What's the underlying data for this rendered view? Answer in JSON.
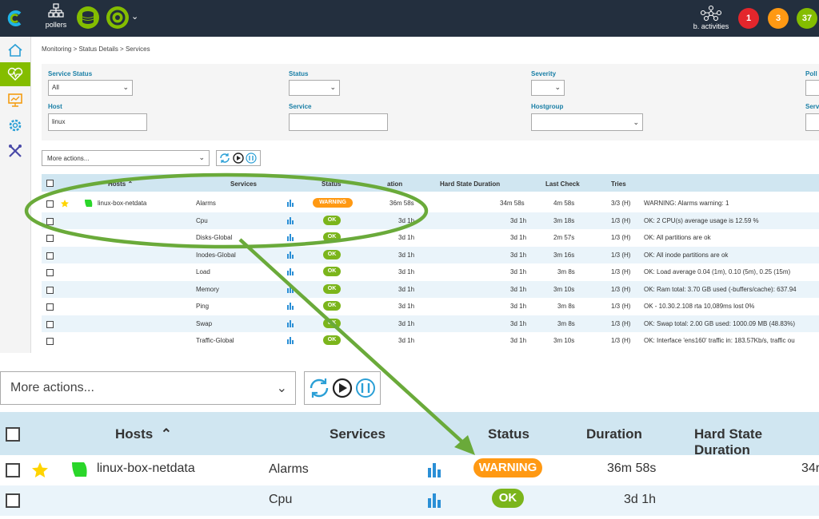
{
  "topbar": {
    "pollers_label": "pollers",
    "activities_label": "b. activities",
    "badges": [
      {
        "value": "1",
        "color": "#e3262c"
      },
      {
        "value": "3",
        "color": "#ff9913"
      },
      {
        "value": "37",
        "color": "#84bd00"
      }
    ]
  },
  "breadcrumb": "Monitoring  >  Status Details  >  Services",
  "filters": {
    "service_status_label": "Service Status",
    "service_status_value": "All",
    "status_label": "Status",
    "severity_label": "Severity",
    "poller_label": "Poll",
    "host_label": "Host",
    "host_value": "linux",
    "service_label": "Service",
    "hostgroup_label": "Hostgroup",
    "servicegroup_label": "Serv"
  },
  "actions": {
    "more_actions": "More actions..."
  },
  "table": {
    "headers": {
      "hosts": "Hosts",
      "services": "Services",
      "status": "Status",
      "duration": "Duration",
      "duration_partial": "ation",
      "hard_state_duration": "Hard State Duration",
      "last_check": "Last Check",
      "tries": "Tries"
    },
    "rows": [
      {
        "host": "linux-box-netdata",
        "service": "Alarms",
        "status": "WARNING",
        "duration": "36m 58s",
        "hard": "34m 58s",
        "last": "4m 58s",
        "tries": "3/3 (H)",
        "info": "WARNING: Alarms warning: 1"
      },
      {
        "host": "",
        "service": "Cpu",
        "status": "OK",
        "duration": "3d 1h",
        "hard": "3d 1h",
        "last": "3m 18s",
        "tries": "1/3 (H)",
        "info": "OK: 2 CPU(s) average usage is 12.59 %"
      },
      {
        "host": "",
        "service": "Disks-Global",
        "status": "OK",
        "duration": "3d 1h",
        "hard": "3d 1h",
        "last": "2m 57s",
        "tries": "1/3 (H)",
        "info": "OK: All partitions are ok"
      },
      {
        "host": "",
        "service": "Inodes-Global",
        "status": "OK",
        "duration": "3d 1h",
        "hard": "3d 1h",
        "last": "3m 16s",
        "tries": "1/3 (H)",
        "info": "OK: All inode partitions are ok"
      },
      {
        "host": "",
        "service": "Load",
        "status": "OK",
        "duration": "3d 1h",
        "hard": "3d 1h",
        "last": "3m 8s",
        "tries": "1/3 (H)",
        "info": "OK: Load average 0.04 (1m), 0.10 (5m), 0.25 (15m)"
      },
      {
        "host": "",
        "service": "Memory",
        "status": "OK",
        "duration": "3d 1h",
        "hard": "3d 1h",
        "last": "3m 10s",
        "tries": "1/3 (H)",
        "info": "OK: Ram total: 3.70 GB used (-buffers/cache): 637.94"
      },
      {
        "host": "",
        "service": "Ping",
        "status": "OK",
        "duration": "3d 1h",
        "hard": "3d 1h",
        "last": "3m 8s",
        "tries": "1/3 (H)",
        "info": "OK - 10.30.2.108 rta 10,089ms lost 0%"
      },
      {
        "host": "",
        "service": "Swap",
        "status": "OK",
        "duration": "3d 1h",
        "hard": "3d 1h",
        "last": "3m 8s",
        "tries": "1/3 (H)",
        "info": "OK: Swap total: 2.00 GB used: 1000.09 MB (48.83%)"
      },
      {
        "host": "",
        "service": "Traffic-Global",
        "status": "OK",
        "duration": "3d 1h",
        "hard": "3d 1h",
        "last": "3m 10s",
        "tries": "1/3 (H)",
        "info": "OK: Interface 'ens160' traffic in: 183.57Kb/s, traffic ou"
      }
    ]
  },
  "zoom": {
    "hard_partial": "34r"
  },
  "colors": {
    "header_bg": "#232f3e",
    "accent_green": "#84bd00",
    "highlight_green": "#6aaa3a",
    "warning": "#ff9913",
    "ok": "#7bb51b",
    "table_header": "#d0e6f1"
  }
}
